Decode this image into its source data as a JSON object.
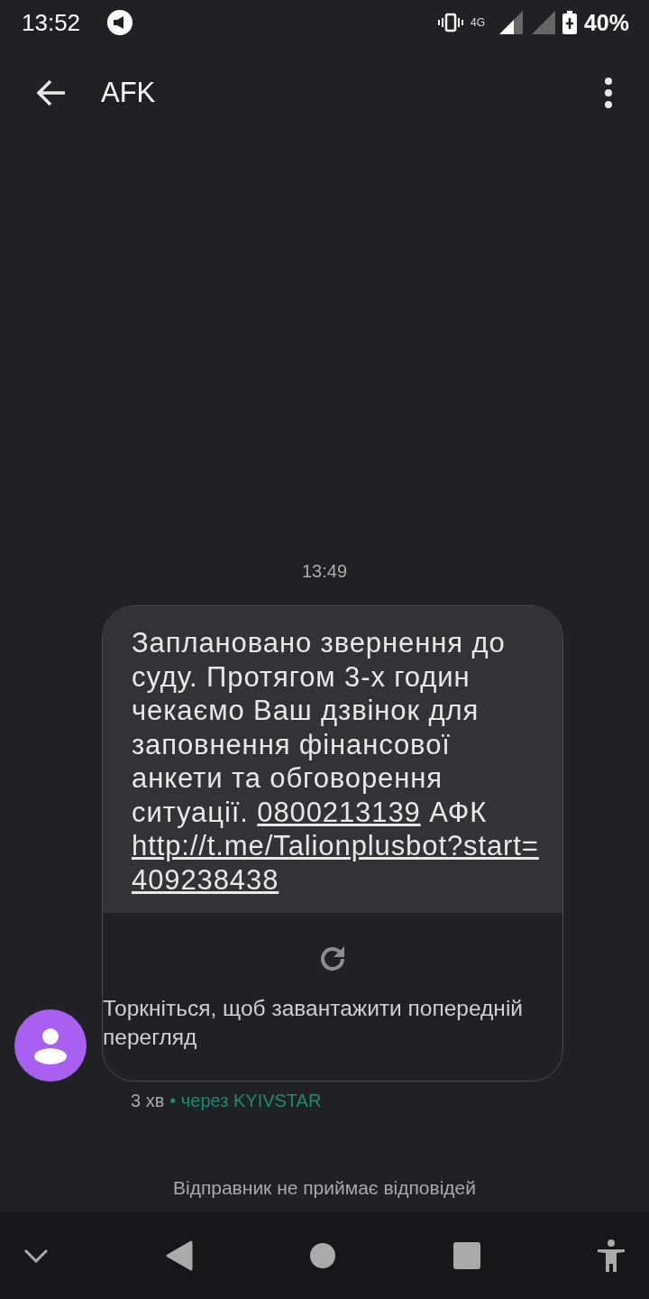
{
  "status_bar": {
    "time": "13:52",
    "network": "4G",
    "battery": "40%"
  },
  "header": {
    "title": "AFK"
  },
  "conversation": {
    "timestamp": "13:49",
    "message": {
      "parts": [
        {
          "kind": "text",
          "text": "Заплановано звернення до суду. Протягом 3-х годин чекаємо Ваш дзвінок для заповнення фінансової анкети та обговорення ситуації. "
        },
        {
          "kind": "link",
          "text": "0800213139"
        },
        {
          "kind": "text",
          "text": " АФК "
        },
        {
          "kind": "link",
          "text": "http://t.me/Talionplusbot?start=409238438"
        }
      ],
      "preview_hint": "Торкніться, щоб завантажити попередній перегляд",
      "age": "3 хв",
      "via": "• через KYIVSTAR"
    }
  },
  "footer": {
    "notice": "Відправник не приймає відповідей"
  }
}
